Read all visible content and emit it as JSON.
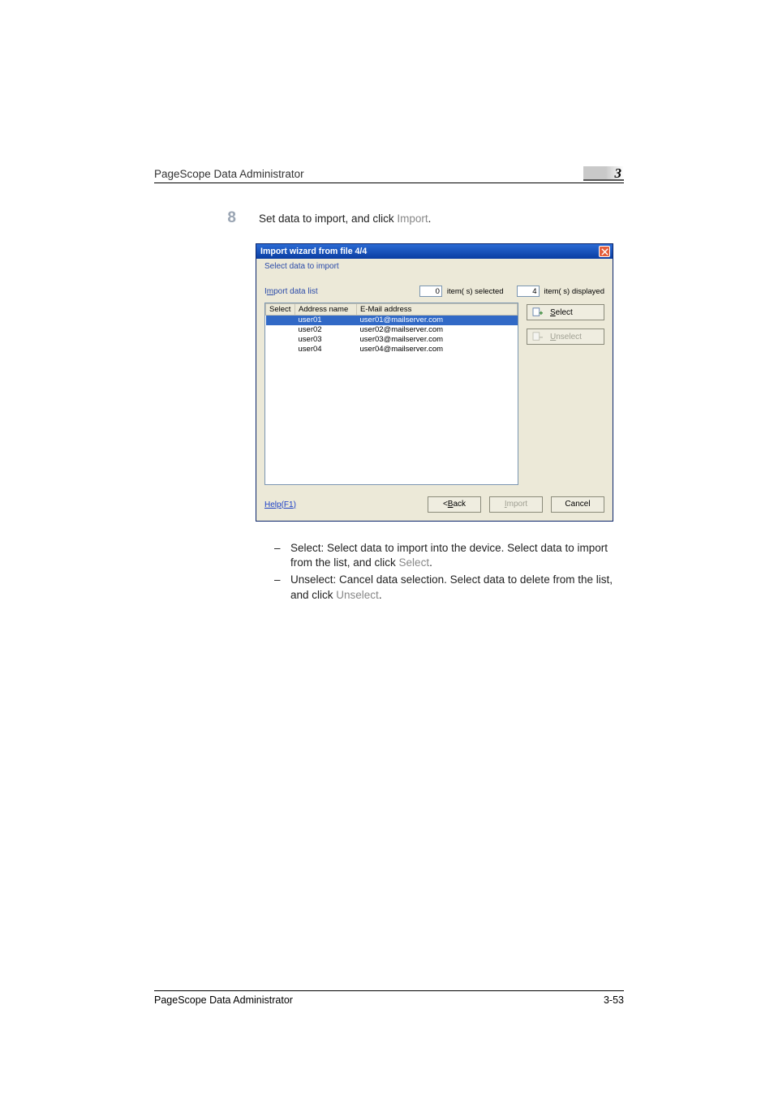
{
  "header": {
    "title": "PageScope Data Administrator",
    "chapter": "3"
  },
  "step": {
    "number": "8",
    "text_prefix": "Set data to import, and click ",
    "button_ref": "Import",
    "text_suffix": "."
  },
  "dialog": {
    "title": "Import wizard from file 4/4",
    "subtitle": "Select data to import",
    "import_list_label_pre": "I",
    "import_list_label_u": "m",
    "import_list_label_post": "port data list",
    "selected_count": "0",
    "selected_label": "item( s) selected",
    "displayed_count": "4",
    "displayed_label": "item( s) displayed",
    "columns": {
      "select": "Select",
      "address_name": "Address name",
      "email": "E-Mail address"
    },
    "rows": [
      {
        "name": "user01",
        "email": "user01@mailserver.com",
        "selected": true
      },
      {
        "name": "user02",
        "email": "user02@mailserver.com",
        "selected": false
      },
      {
        "name": "user03",
        "email": "user03@mailserver.com",
        "selected": false
      },
      {
        "name": "user04",
        "email": "user04@mailserver.com",
        "selected": false
      }
    ],
    "side_buttons": {
      "select_u": "S",
      "select_rest": "elect",
      "unselect_u": "U",
      "unselect_rest": "nselect"
    },
    "footer": {
      "help": "Help(F1)",
      "back_lt": "<",
      "back_u": "B",
      "back_rest": "ack",
      "import_u": "I",
      "import_rest": "mport",
      "cancel": "Cancel"
    }
  },
  "bullets": [
    {
      "prefix": "Select: Select data to import into the device. Select data to import from the list, and click ",
      "ref": "Select",
      "suffix": "."
    },
    {
      "prefix": "Unselect: Cancel data selection. Select data to delete from the list, and click ",
      "ref": "Unselect",
      "suffix": "."
    }
  ],
  "footer": {
    "left": "PageScope Data Administrator",
    "right": "3-53"
  }
}
